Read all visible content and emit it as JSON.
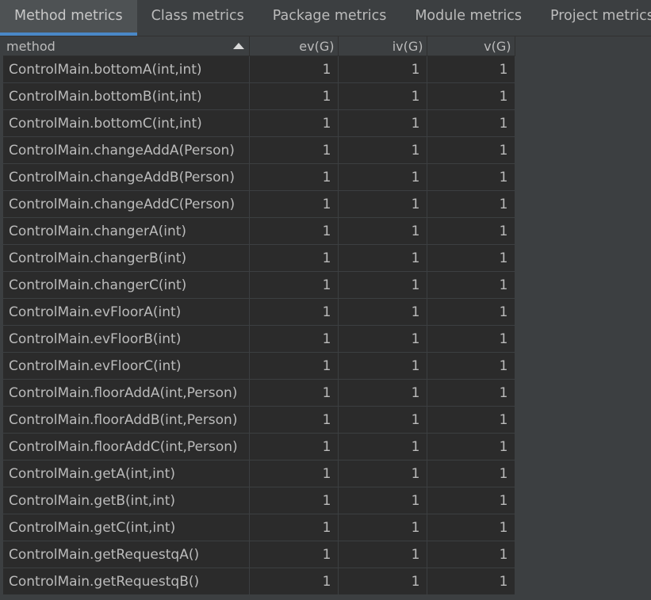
{
  "tabs": [
    {
      "label": "Method metrics",
      "active": true
    },
    {
      "label": "Class metrics",
      "active": false
    },
    {
      "label": "Package metrics",
      "active": false
    },
    {
      "label": "Module metrics",
      "active": false
    },
    {
      "label": "Project metrics",
      "active": false
    }
  ],
  "table": {
    "columns": [
      "method",
      "ev(G)",
      "iv(G)",
      "v(G)"
    ],
    "sort": {
      "column": "method",
      "direction": "ascending"
    },
    "rows": [
      [
        "ControlMain.bottomA(int,int)",
        "1",
        "1",
        "1"
      ],
      [
        "ControlMain.bottomB(int,int)",
        "1",
        "1",
        "1"
      ],
      [
        "ControlMain.bottomC(int,int)",
        "1",
        "1",
        "1"
      ],
      [
        "ControlMain.changeAddA(Person)",
        "1",
        "1",
        "1"
      ],
      [
        "ControlMain.changeAddB(Person)",
        "1",
        "1",
        "1"
      ],
      [
        "ControlMain.changeAddC(Person)",
        "1",
        "1",
        "1"
      ],
      [
        "ControlMain.changerA(int)",
        "1",
        "1",
        "1"
      ],
      [
        "ControlMain.changerB(int)",
        "1",
        "1",
        "1"
      ],
      [
        "ControlMain.changerC(int)",
        "1",
        "1",
        "1"
      ],
      [
        "ControlMain.evFloorA(int)",
        "1",
        "1",
        "1"
      ],
      [
        "ControlMain.evFloorB(int)",
        "1",
        "1",
        "1"
      ],
      [
        "ControlMain.evFloorC(int)",
        "1",
        "1",
        "1"
      ],
      [
        "ControlMain.floorAddA(int,Person)",
        "1",
        "1",
        "1"
      ],
      [
        "ControlMain.floorAddB(int,Person)",
        "1",
        "1",
        "1"
      ],
      [
        "ControlMain.floorAddC(int,Person)",
        "1",
        "1",
        "1"
      ],
      [
        "ControlMain.getA(int,int)",
        "1",
        "1",
        "1"
      ],
      [
        "ControlMain.getB(int,int)",
        "1",
        "1",
        "1"
      ],
      [
        "ControlMain.getC(int,int)",
        "1",
        "1",
        "1"
      ],
      [
        "ControlMain.getRequestqA()",
        "1",
        "1",
        "1"
      ],
      [
        "ControlMain.getRequestqB()",
        "1",
        "1",
        "1"
      ]
    ]
  },
  "colors": {
    "panel_bg": "#3c3f41",
    "cell_bg": "#2b2b2b",
    "text": "#bbbbbb",
    "active_tab_bg": "#4e5254",
    "accent_underline": "#4a88c7"
  },
  "icons": {
    "sort": "sort-ascending-icon"
  }
}
